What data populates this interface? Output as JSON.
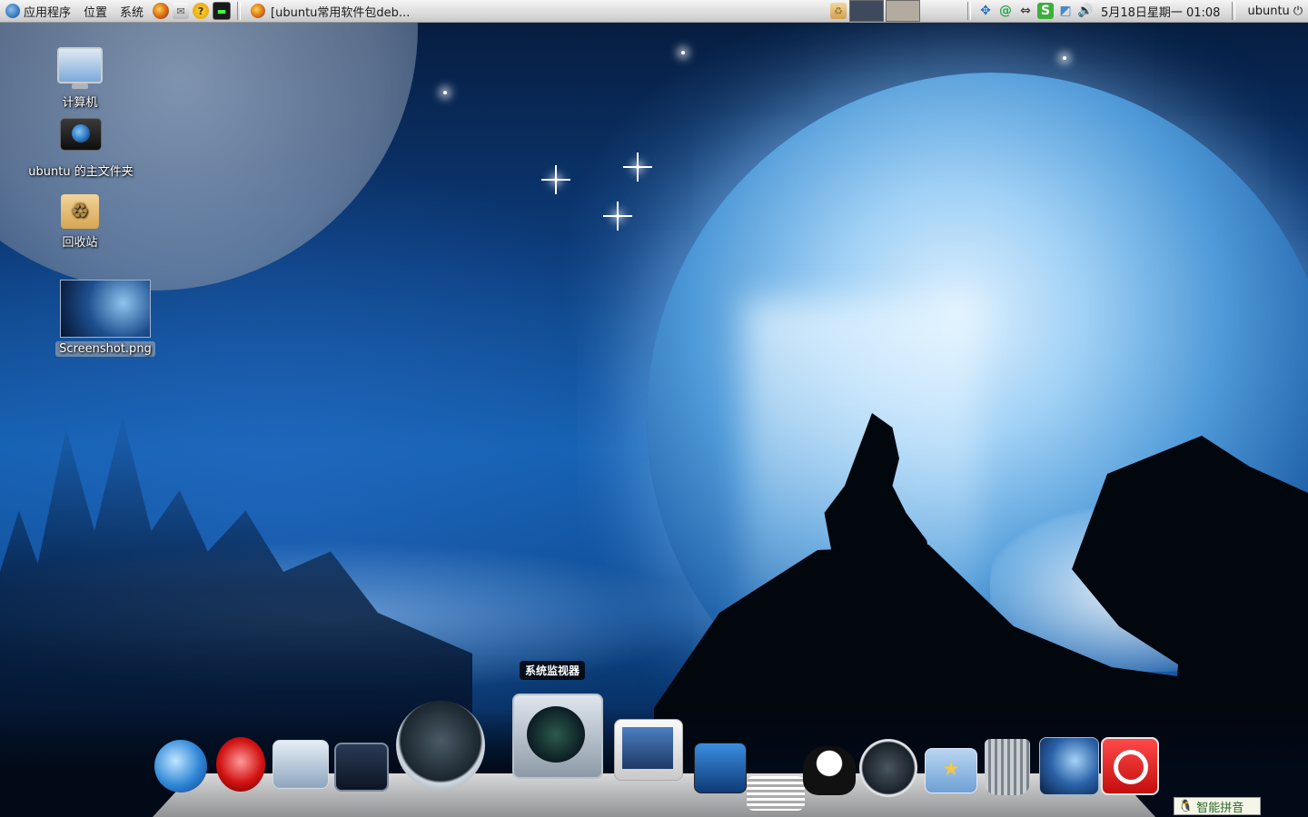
{
  "top_panel": {
    "menus": [
      "应用程序",
      "位置",
      "系统"
    ],
    "launchers": [
      "firefox-icon",
      "mail-icon",
      "help-icon",
      "system-monitor-icon"
    ],
    "taskbar_title": "[ubuntu常用软件包deb...",
    "clock": "5月18日星期一 01:08",
    "user": "ubuntu",
    "colors": {
      "panel_top": "#f4f4f4",
      "panel_bottom": "#c8c8c8"
    }
  },
  "desktop": {
    "icons": [
      {
        "label": "计算机",
        "icon": "computer-icon"
      },
      {
        "label": "ubuntu 的主文件夹",
        "icon": "home-folder-icon"
      },
      {
        "label": "回收站",
        "icon": "trash-icon"
      },
      {
        "label": "Screenshot.png",
        "icon": "image-thumbnail-icon",
        "selected": true
      }
    ]
  },
  "dock": {
    "tooltip": "系统监视器",
    "items": [
      "ie-icon",
      "opera-icon",
      "camera-icon",
      "workspace-icon",
      "time-machine-icon",
      "system-monitor-icon",
      "photos-icon",
      "movie-icon",
      "tux-icon",
      "safari-icon",
      "favorites-folder-icon",
      "trash-icon",
      "desktop-switcher-icon",
      "power-icon"
    ]
  },
  "ime": {
    "label": "智能拼音"
  }
}
